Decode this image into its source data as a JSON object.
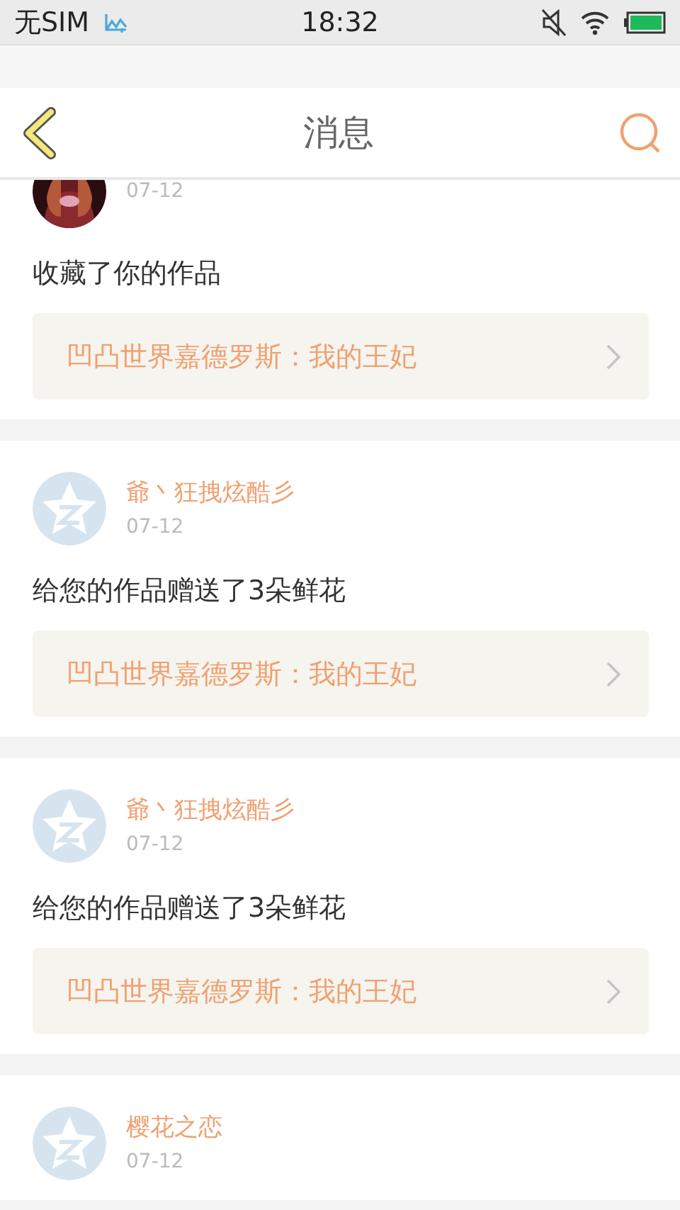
{
  "status_bar": {
    "carrier": "无SIM",
    "time": "18:32"
  },
  "header": {
    "title": "消息"
  },
  "messages": [
    {
      "date": "07-12",
      "text": "收藏了你的作品",
      "work": "凹凸世界嘉德罗斯：我的王妃"
    },
    {
      "avatar": {
        "kind": "default"
      },
      "user": "爺丶狂拽炫酷彡",
      "date": "07-12",
      "text": "给您的作品赠送了3朵鲜花",
      "work": "凹凸世界嘉德罗斯：我的王妃"
    },
    {
      "avatar": {
        "kind": "default"
      },
      "user": "爺丶狂拽炫酷彡",
      "date": "07-12",
      "text": "给您的作品赠送了3朵鲜花",
      "work": "凹凸世界嘉德罗斯：我的王妃"
    },
    {
      "avatar": {
        "kind": "default"
      },
      "user": "樱花之恋",
      "date": "07-12"
    }
  ]
}
